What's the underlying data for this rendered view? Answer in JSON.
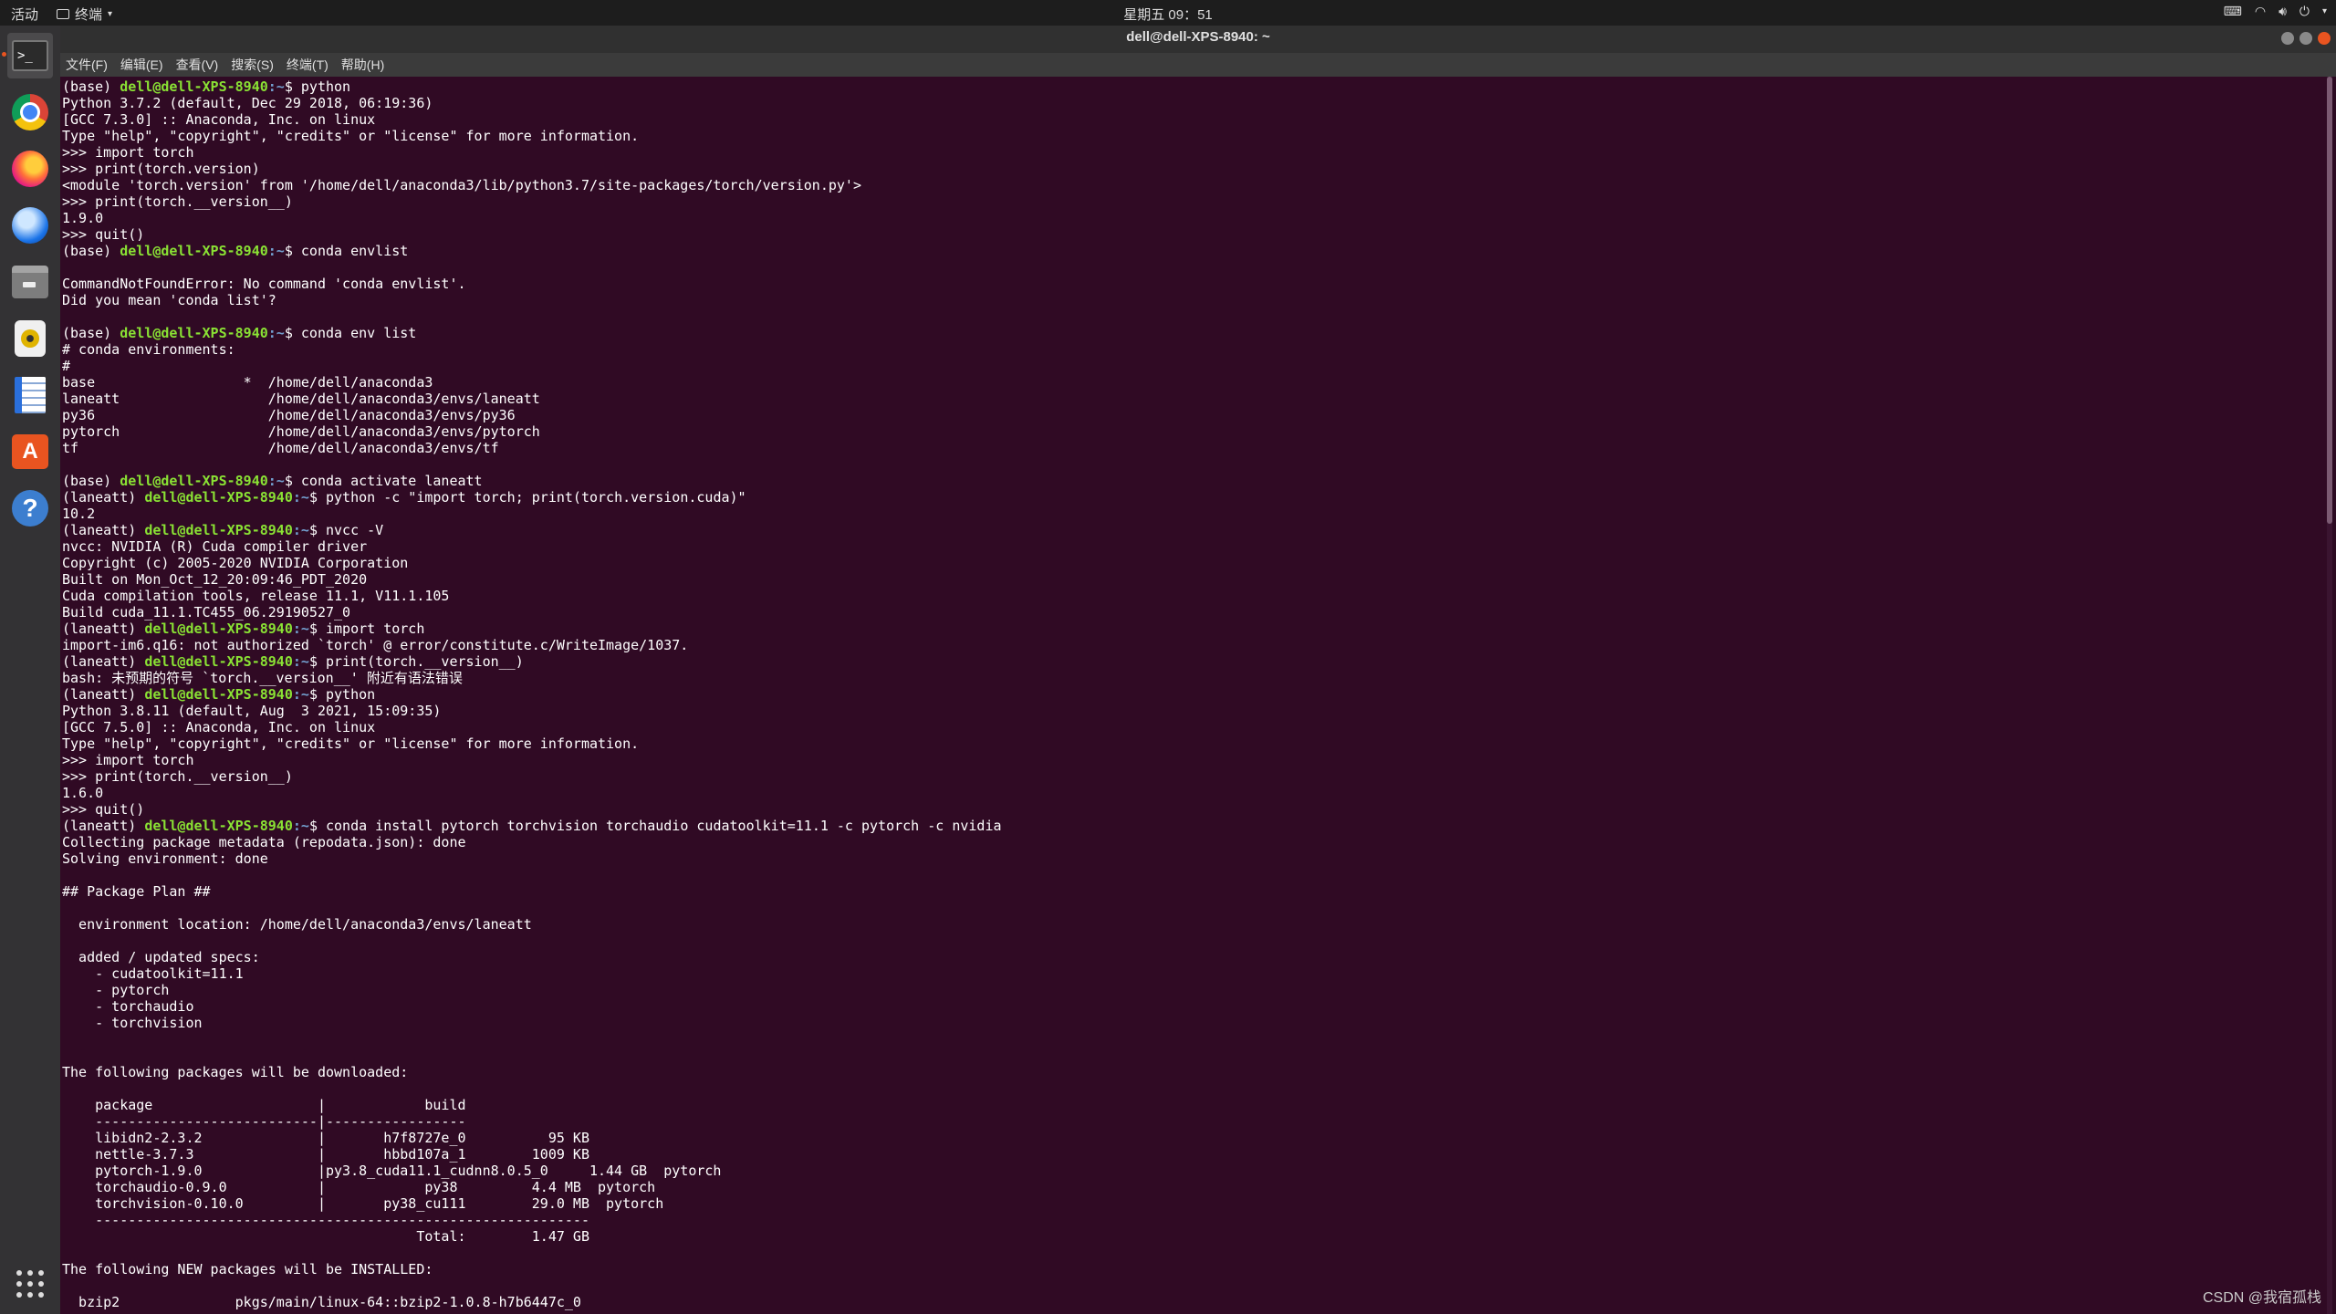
{
  "topbar": {
    "activities": "活动",
    "app_menu": "终端",
    "clock": "星期五 09：51"
  },
  "dock": {
    "items": [
      {
        "name": "terminal"
      },
      {
        "name": "chrome"
      },
      {
        "name": "firefox"
      },
      {
        "name": "thunderbird"
      },
      {
        "name": "files"
      },
      {
        "name": "rhythmbox"
      },
      {
        "name": "libreoffice-writer"
      },
      {
        "name": "ubuntu-software"
      },
      {
        "name": "help"
      }
    ]
  },
  "window": {
    "title": "dell@dell-XPS-8940: ~"
  },
  "menu": {
    "file": "文件(F)",
    "edit": "编辑(E)",
    "view": "查看(V)",
    "search": "搜索(S)",
    "terminal": "终端(T)",
    "help": "帮助(H)"
  },
  "terminal": {
    "user_host": "dell@dell-XPS-8940",
    "lines": [
      {
        "p": "(base) ",
        "h": true,
        "d": ":~",
        "t": "$ python"
      },
      {
        "t": "Python 3.7.2 (default, Dec 29 2018, 06:19:36)"
      },
      {
        "t": "[GCC 7.3.0] :: Anaconda, Inc. on linux"
      },
      {
        "t": "Type \"help\", \"copyright\", \"credits\" or \"license\" for more information."
      },
      {
        "t": ">>> import torch"
      },
      {
        "t": ">>> print(torch.version)"
      },
      {
        "t": "<module 'torch.version' from '/home/dell/anaconda3/lib/python3.7/site-packages/torch/version.py'>"
      },
      {
        "t": ">>> print(torch.__version__)"
      },
      {
        "t": "1.9.0"
      },
      {
        "t": ">>> quit()"
      },
      {
        "p": "(base) ",
        "h": true,
        "d": ":~",
        "t": "$ conda envlist"
      },
      {
        "t": ""
      },
      {
        "t": "CommandNotFoundError: No command 'conda envlist'."
      },
      {
        "t": "Did you mean 'conda list'?"
      },
      {
        "t": ""
      },
      {
        "p": "(base) ",
        "h": true,
        "d": ":~",
        "t": "$ conda env list"
      },
      {
        "t": "# conda environments:"
      },
      {
        "t": "#"
      },
      {
        "t": "base                  *  /home/dell/anaconda3"
      },
      {
        "t": "laneatt                  /home/dell/anaconda3/envs/laneatt"
      },
      {
        "t": "py36                     /home/dell/anaconda3/envs/py36"
      },
      {
        "t": "pytorch                  /home/dell/anaconda3/envs/pytorch"
      },
      {
        "t": "tf                       /home/dell/anaconda3/envs/tf"
      },
      {
        "t": ""
      },
      {
        "p": "(base) ",
        "h": true,
        "d": ":~",
        "t": "$ conda activate laneatt"
      },
      {
        "p": "(laneatt) ",
        "h": true,
        "d": ":~",
        "t": "$ python -c \"import torch; print(torch.version.cuda)\""
      },
      {
        "t": "10.2"
      },
      {
        "p": "(laneatt) ",
        "h": true,
        "d": ":~",
        "t": "$ nvcc -V"
      },
      {
        "t": "nvcc: NVIDIA (R) Cuda compiler driver"
      },
      {
        "t": "Copyright (c) 2005-2020 NVIDIA Corporation"
      },
      {
        "t": "Built on Mon_Oct_12_20:09:46_PDT_2020"
      },
      {
        "t": "Cuda compilation tools, release 11.1, V11.1.105"
      },
      {
        "t": "Build cuda_11.1.TC455_06.29190527_0"
      },
      {
        "p": "(laneatt) ",
        "h": true,
        "d": ":~",
        "t": "$ import torch"
      },
      {
        "t": "import-im6.q16: not authorized `torch' @ error/constitute.c/WriteImage/1037."
      },
      {
        "p": "(laneatt) ",
        "h": true,
        "d": ":~",
        "t": "$ print(torch.__version__)"
      },
      {
        "t": "bash: 未预期的符号 `torch.__version__' 附近有语法错误"
      },
      {
        "p": "(laneatt) ",
        "h": true,
        "d": ":~",
        "t": "$ python"
      },
      {
        "t": "Python 3.8.11 (default, Aug  3 2021, 15:09:35)"
      },
      {
        "t": "[GCC 7.5.0] :: Anaconda, Inc. on linux"
      },
      {
        "t": "Type \"help\", \"copyright\", \"credits\" or \"license\" for more information."
      },
      {
        "t": ">>> import torch"
      },
      {
        "t": ">>> print(torch.__version__)"
      },
      {
        "t": "1.6.0"
      },
      {
        "t": ">>> quit()"
      },
      {
        "p": "(laneatt) ",
        "h": true,
        "d": ":~",
        "t": "$ conda install pytorch torchvision torchaudio cudatoolkit=11.1 -c pytorch -c nvidia"
      },
      {
        "t": "Collecting package metadata (repodata.json): done"
      },
      {
        "t": "Solving environment: done"
      },
      {
        "t": ""
      },
      {
        "t": "## Package Plan ##"
      },
      {
        "t": ""
      },
      {
        "t": "  environment location: /home/dell/anaconda3/envs/laneatt"
      },
      {
        "t": ""
      },
      {
        "t": "  added / updated specs:"
      },
      {
        "t": "    - cudatoolkit=11.1"
      },
      {
        "t": "    - pytorch"
      },
      {
        "t": "    - torchaudio"
      },
      {
        "t": "    - torchvision"
      },
      {
        "t": ""
      },
      {
        "t": ""
      },
      {
        "t": "The following packages will be downloaded:"
      },
      {
        "t": ""
      },
      {
        "t": "    package                    |            build"
      },
      {
        "t": "    ---------------------------|-----------------"
      },
      {
        "t": "    libidn2-2.3.2              |       h7f8727e_0          95 KB"
      },
      {
        "t": "    nettle-3.7.3               |       hbbd107a_1        1009 KB"
      },
      {
        "t": "    pytorch-1.9.0              |py3.8_cuda11.1_cudnn8.0.5_0     1.44 GB  pytorch"
      },
      {
        "t": "    torchaudio-0.9.0           |            py38         4.4 MB  pytorch"
      },
      {
        "t": "    torchvision-0.10.0         |       py38_cu111        29.0 MB  pytorch"
      },
      {
        "t": "    ------------------------------------------------------------"
      },
      {
        "t": "                                           Total:        1.47 GB"
      },
      {
        "t": ""
      },
      {
        "t": "The following NEW packages will be INSTALLED:"
      },
      {
        "t": ""
      },
      {
        "t": "  bzip2              pkgs/main/linux-64::bzip2-1.0.8-h7b6447c_0"
      }
    ]
  },
  "watermark": "CSDN @我宿孤栈"
}
